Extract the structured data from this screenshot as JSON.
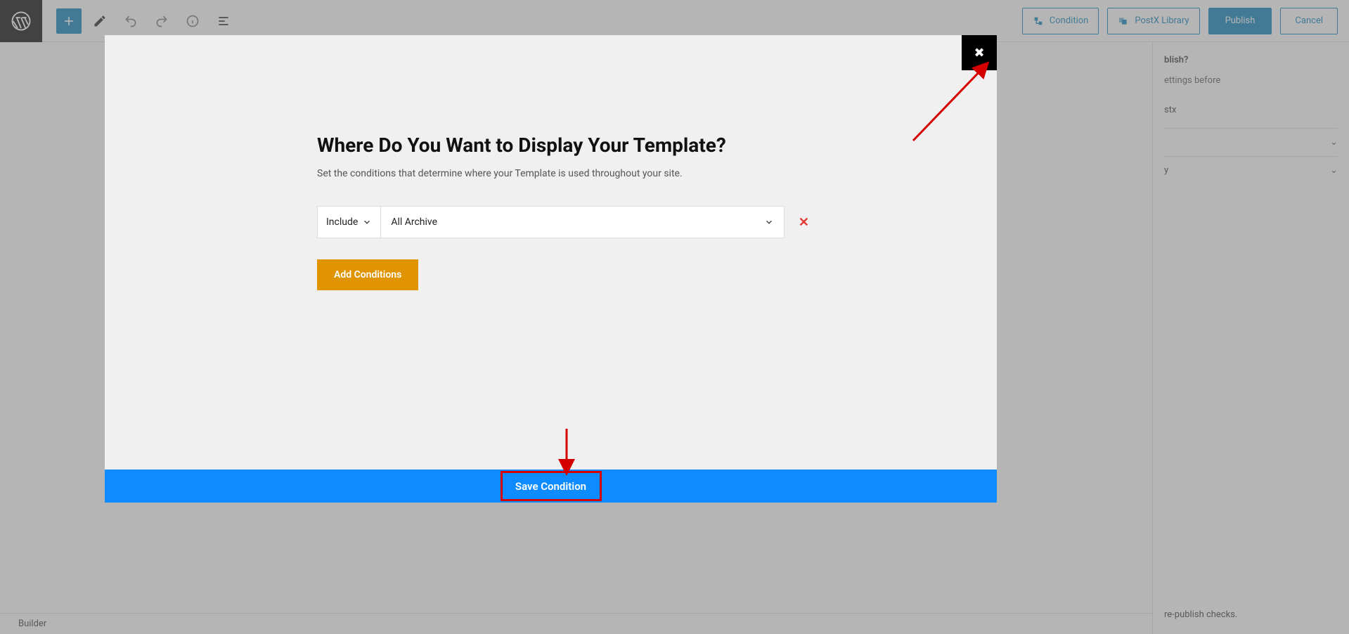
{
  "toolbar": {
    "condition_label": "Condition",
    "library_label": "PostX Library",
    "publish_label": "Publish",
    "cancel_label": "Cancel"
  },
  "sidebar": {
    "heading_suffix": "blish?",
    "desc_suffix": "ettings before",
    "item1": "stx",
    "section_summary": "y",
    "footer_text": "re-publish checks."
  },
  "footer": {
    "text": "Builder"
  },
  "modal": {
    "title": "Where Do You Want to Display Your Template?",
    "subtitle": "Set the conditions that determine where your Template is used throughout your site.",
    "include_label": "Include",
    "target_label": "All Archive",
    "add_conditions_label": "Add Conditions",
    "save_label": "Save Condition"
  }
}
